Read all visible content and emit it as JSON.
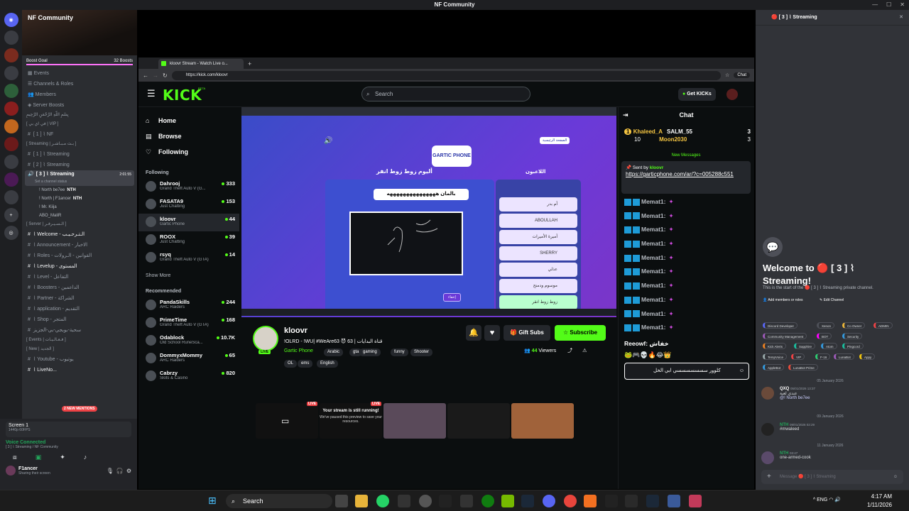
{
  "os": {
    "window_title": "NF Community",
    "taskbar": {
      "search": "Search",
      "lang": "ENG",
      "time": "4:17 AM",
      "date": "1/11/2026"
    }
  },
  "discord": {
    "server_name": "NF Community",
    "boost_goal": "Boost Goal",
    "boosts": "32 Boosts",
    "nav": [
      "Events",
      "Channels & Roles",
      "Members",
      "Server Boosts"
    ],
    "channels": [
      {
        "t": "cat",
        "label": "بِسْمِ اللّهِ الرَّحْمَنِ الرَّحِيمِ"
      },
      {
        "t": "cat",
        "label": "[ في اي بي | VIP ]"
      },
      {
        "t": "ch",
        "label": "[ 1 ] ⌇ NF"
      },
      {
        "t": "cat",
        "label": "[ Streaming | بـث مـبـاشـر ]"
      },
      {
        "t": "ch",
        "label": "[ 1 ] ⌇ Streaming"
      },
      {
        "t": "ch",
        "label": "[ 2 ] ⌇ Streaming"
      },
      {
        "t": "sel",
        "label": "[ 3 ] ⌇ Streaming",
        "time": "2:01:55",
        "status": "Set a channel status"
      },
      {
        "t": "vu",
        "label": "! North be7ee",
        "badge": "NTH",
        "live": "LIVE"
      },
      {
        "t": "vu",
        "label": "! North | F1ancer",
        "badge": "NTH",
        "live": "LIVE"
      },
      {
        "t": "vu",
        "label": "! Mr. Kiija"
      },
      {
        "t": "vu",
        "label": "ABO_MaliR"
      },
      {
        "t": "cat",
        "label": "[ Server | الـسـيـرفـر ]"
      },
      {
        "t": "w",
        "label": "⌇ Welcome - الـتـرحـيـب"
      },
      {
        "t": "ch",
        "label": "⌇ Announcement - الاخبار"
      },
      {
        "t": "ch",
        "label": "⌇ Roles - القوانين - الـرولات"
      },
      {
        "t": "w",
        "label": "⌇ Levelup - المستوى"
      },
      {
        "t": "ch",
        "label": "⌇ Level - التفاعل"
      },
      {
        "t": "ch",
        "label": "⌇ Boosters - الداعمين"
      },
      {
        "t": "ch",
        "label": "⌇ Partner - الشراكة"
      },
      {
        "t": "ch",
        "label": "⌇ application - التقديم"
      },
      {
        "t": "ch",
        "label": "⌇ Shop - المتجر"
      },
      {
        "t": "ch",
        "label": "سحبة-بوبجي-بي-الجزيز"
      },
      {
        "t": "cat",
        "label": "[ Events | فـعـالـيـات ]"
      },
      {
        "t": "cat",
        "label": "[ New | الجديد ]"
      },
      {
        "t": "ch",
        "label": "⌇ Youtube - يوتيوب"
      },
      {
        "t": "w",
        "label": "⌇ LiveNo..."
      }
    ],
    "mentions": "2 NEW MENTIONS",
    "screen": {
      "label": "Screen 1",
      "sub": "1440p 60FPS"
    },
    "voice": {
      "status": "Voice Connected",
      "channel": "[ 3 ] ⌇ Streaming / NF Community"
    },
    "user": {
      "name": "F1ancer",
      "status": "Sharing their screen"
    }
  },
  "browser": {
    "tab": "kloovr Stream - Watch Live o...",
    "url": "https://kick.com/kloovr",
    "chat_btn": "Chat"
  },
  "kick": {
    "logo": "KICK",
    "beta": "BETA",
    "search": "Search",
    "get_kicks": "Get KICKs",
    "nav": [
      {
        "label": "Home",
        "icon": "home-icon"
      },
      {
        "label": "Browse",
        "icon": "browse-icon"
      },
      {
        "label": "Following",
        "icon": "heart-icon"
      }
    ],
    "following_label": "Following",
    "following": [
      {
        "name": "Dahrooj",
        "game": "Grand Theft Auto V (G...",
        "viewers": "333"
      },
      {
        "name": "FASATA9",
        "game": "Just Chatting",
        "viewers": "153"
      },
      {
        "name": "kloovr",
        "game": "Gartic Phone",
        "viewers": "44"
      },
      {
        "name": "ROOX",
        "game": "Just Chatting",
        "viewers": "39"
      },
      {
        "name": "rsyq",
        "game": "Grand Theft Auto V (GTA)",
        "viewers": "14"
      }
    ],
    "show_more": "Show More",
    "recommended_label": "Recommended",
    "recommended": [
      {
        "name": "PandaSkills",
        "game": "ARC Raiders",
        "viewers": "244"
      },
      {
        "name": "PrimeTime",
        "game": "Grand Theft Auto V (GTA)",
        "viewers": "168"
      },
      {
        "name": "Odablock",
        "game": "Old School RuneSca...",
        "viewers": "10.7K"
      },
      {
        "name": "DommyxMommy",
        "game": "ARC Raiders",
        "viewers": "65"
      },
      {
        "name": "Cabrzy",
        "game": "Slots & Casino",
        "viewers": "820"
      }
    ],
    "stream": {
      "streamer": "kloovr",
      "live": "LIVE",
      "title": "!OLRD - !WU| #WeAre63 😈 63 | قناة البدايات",
      "game": "Gartic Phone",
      "tags": [
        "Arabic",
        "gta",
        "gaming",
        "funny",
        "Shooter",
        "OL",
        "ems",
        "English"
      ],
      "gift": "Gift Subs",
      "subscribe": "Subscribe",
      "viewers": "44",
      "viewers_label": "Viewers"
    },
    "game": {
      "logo": "GARTIC PHONE",
      "home_btn": "الصفحة الرئيسية",
      "album": "أليوم زوط زوط انفر",
      "players_title": "اللاعبون",
      "players": [
        "أم بدر",
        "ABOULLAH",
        "أميرة الأميرات",
        "SHERRY",
        "عذلي",
        "موسوم ودمنح",
        "زوط زوط انقر"
      ],
      "caption": "بالمان هههههههههههههههه",
      "hide_btn": "إخفاء"
    },
    "chat": {
      "title": "Chat",
      "top": [
        {
          "rank": "1",
          "name": "Khaleed_A",
          "val": "10"
        },
        {
          "name": "SALM_55",
          "val": "3"
        },
        {
          "name": "Moon2030",
          "val": "3"
        }
      ],
      "new_messages": "New Messages",
      "pinned": {
        "sent_by": "Sent by",
        "user": "kloovr",
        "link": "https://garticphone.com/ar/?c=005288c551"
      },
      "messages": [
        "Memat1:",
        "Memat1:",
        "Memat1:",
        "Memat1:",
        "Memat1:",
        "Memat1:",
        "Memat1:",
        "Memat1:",
        "Memat1:",
        "Memat1:"
      ],
      "last": "Reeowf: خفاش",
      "input": "كلوور سسسسسسسي ابي الخل"
    },
    "strip": {
      "live": "LIVE",
      "paused_title": "Your stream is still running!",
      "paused_sub": "We've paused this preview to save your resources."
    }
  },
  "right": {
    "header": "🔴 [ 3 ] ⌇ Streaming",
    "welcome": "Welcome to 🔴 [ 3 ] ⌇ Streaming!",
    "sub": "This is the start of the 🔴 [ 3 ] ⌇ Streaming private channel.",
    "add_members": "Add members or roles",
    "edit_channel": "Edit Channel",
    "roles": [
      "Discord Developer",
      "Xenon",
      "Co Owner",
      "ADMIN",
      "Community Management",
      "BOT",
      "Security",
      "Kick Alerts",
      "Sapphire",
      "Atom",
      "Pingcord",
      "TempVoice",
      "VIP",
      "F-16",
      "LunaBot",
      "Appy",
      "AppleBot",
      "LunaBot Prime"
    ],
    "d1": "05 January 2026",
    "m1_user": "QXQ",
    "m1_time": "05/01/2026 13:37",
    "m1_text": "عندي لعبة",
    "m1_mention": "@! North be7ee",
    "d2": "09 January 2026",
    "m2_user": "NTH",
    "m2_time": "09/01/2026 02:29",
    "m2_text": "#mwaleed",
    "d3": "11 January 2026",
    "m3_user": "NTH",
    "m3_time": "03:47",
    "m3_text": "one-armed-cook",
    "input": "Message 🔴 [ 3 ] ⌇ Streaming"
  },
  "colors": {
    "kick_green": "#53fc18",
    "discord_bg": "#313338",
    "discord_sidebar": "#2b2d31",
    "live_red": "#ed4245"
  }
}
